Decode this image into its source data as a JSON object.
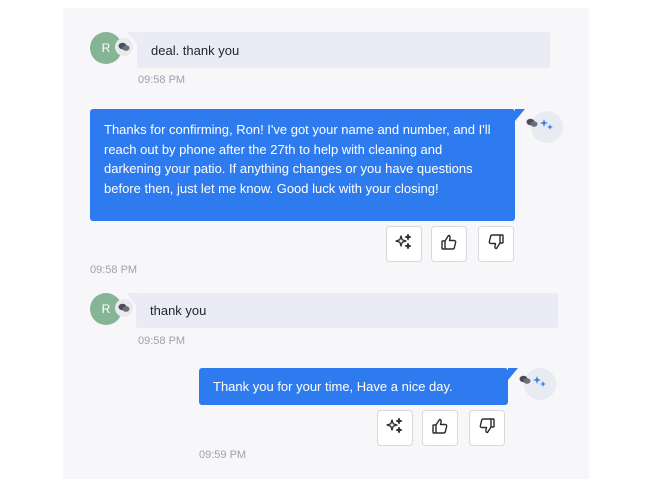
{
  "messages": [
    {
      "role": "user",
      "avatar_initial": "R",
      "text": "deal.  thank you",
      "time": "09:58 PM"
    },
    {
      "role": "assistant",
      "text": "Thanks for confirming, Ron! I've got your name and number, and I'll reach out by phone after the 27th to help with cleaning and darkening your patio. If anything changes or you have questions before then, just let me know. Good luck with your closing!",
      "time": "09:58 PM"
    },
    {
      "role": "user",
      "avatar_initial": "R",
      "text": "thank you",
      "time": "09:58 PM"
    },
    {
      "role": "assistant",
      "text": "Thank you for your time, Have a nice day.",
      "time": "09:59 PM"
    }
  ],
  "icons": {
    "user_badge": "chat-bubbles-icon",
    "assistant_avatar": "sparkle-icon",
    "assistant_badge": "chat-bubbles-icon",
    "actions": [
      "sparkle-icon",
      "thumbs-up-icon",
      "thumbs-down-icon"
    ]
  },
  "colors": {
    "assistant_bubble": "#2e7bf0",
    "user_bubble": "#ebebf5",
    "avatar": "#86b596",
    "timestamp": "#9ea2ad"
  }
}
